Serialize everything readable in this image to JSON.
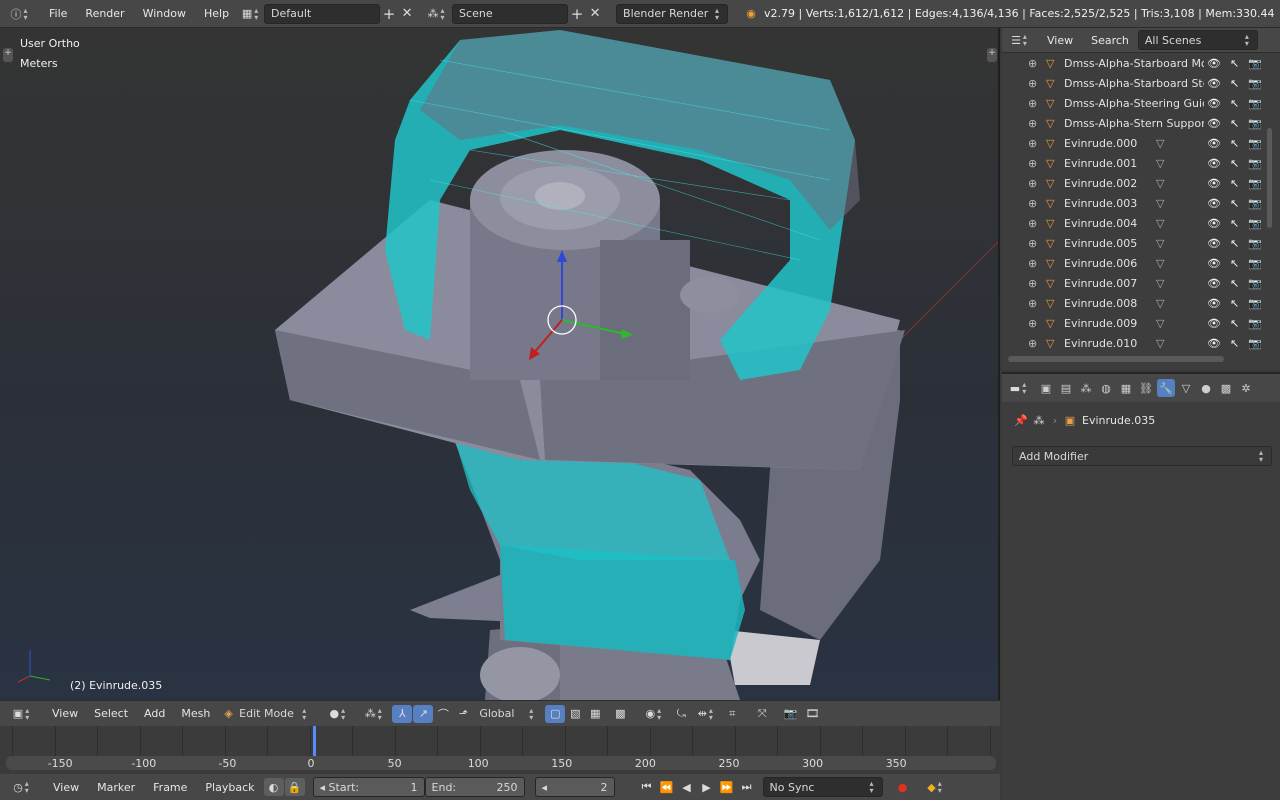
{
  "topbar": {
    "menu": [
      "File",
      "Render",
      "Window",
      "Help"
    ],
    "layout": "Default",
    "scene": "Scene",
    "engine": "Blender Render",
    "stats": "v2.79 | Verts:1,612/1,612 | Edges:4,136/4,136 | Faces:2,525/2,525 | Tris:3,108 | Mem:330.44"
  },
  "viewport": {
    "view_label": "User Ortho",
    "units_label": "Meters",
    "object_label": "(2) Evinrude.035",
    "colors": {
      "wire": "#22d6d6",
      "mesh": "#7f8092",
      "bg_top": "#343434",
      "bg_bottom": "#2a3343"
    }
  },
  "view3d_header": {
    "menu": [
      "View",
      "Select",
      "Add",
      "Mesh"
    ],
    "mode": "Edit Mode",
    "orientation": "Global"
  },
  "timeline": {
    "ticks": [
      "-150",
      "-100",
      "-50",
      "0",
      "50",
      "100",
      "150",
      "200",
      "250",
      "300",
      "350"
    ],
    "current_frame_marker": 2
  },
  "footer": {
    "menu": [
      "View",
      "Marker",
      "Frame",
      "Playback"
    ],
    "start_label": "Start:",
    "start": "1",
    "end_label": "End:",
    "end": "250",
    "current": "2",
    "sync": "No Sync"
  },
  "outliner": {
    "menu": [
      "View",
      "Search"
    ],
    "filter": "All Scenes",
    "items": [
      "Dmss-Alpha-Starboard Moto",
      "Dmss-Alpha-Starboard Stern",
      "Dmss-Alpha-Steering Guide",
      "Dmss-Alpha-Stern Support",
      "Evinrude.000",
      "Evinrude.001",
      "Evinrude.002",
      "Evinrude.003",
      "Evinrude.004",
      "Evinrude.005",
      "Evinrude.006",
      "Evinrude.007",
      "Evinrude.008",
      "Evinrude.009",
      "Evinrude.010"
    ]
  },
  "properties": {
    "object_name": "Evinrude.035",
    "add_modifier": "Add Modifier"
  }
}
